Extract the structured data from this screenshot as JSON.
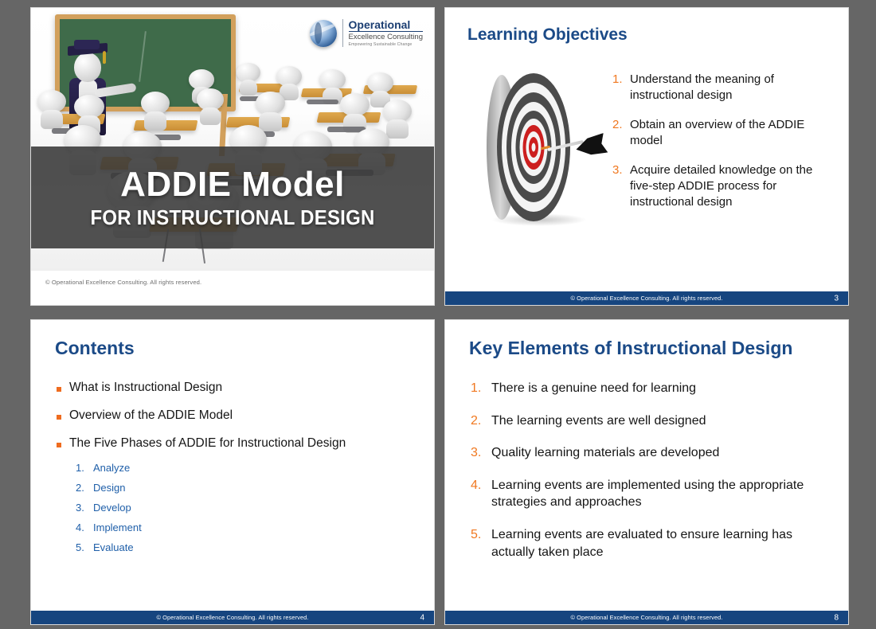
{
  "brand": {
    "logo_main": "Operational",
    "logo_sub": "Excellence Consulting",
    "logo_tagline": "Empowering Sustainable Change",
    "copyright": "© Operational Excellence Consulting.  All rights reserved.",
    "colors": {
      "navy": "#1b4a87",
      "footer_blue": "#16457f",
      "orange": "#f07820",
      "bullet_orange": "#ef6c1f",
      "sub_blue": "#1f5fa9",
      "page_background": "#666666",
      "banner_dark": "#393939"
    }
  },
  "slides": [
    {
      "kind": "title",
      "title": "ADDIE Model",
      "subtitle": "FOR INSTRUCTIONAL DESIGN",
      "image_name": "classroom-3d-illustration",
      "copyright": "© Operational Excellence Consulting.  All rights reserved."
    },
    {
      "kind": "learning-objectives",
      "title": "Learning Objectives",
      "image_name": "target-dartboard-with-dart",
      "items": [
        {
          "num": "1.",
          "text": "Understand the meaning of instructional design"
        },
        {
          "num": "2.",
          "text": "Obtain an overview of the ADDIE model"
        },
        {
          "num": "3.",
          "text": "Acquire detailed knowledge on the five-step ADDIE process for instructional design"
        }
      ],
      "footer": "© Operational Excellence Consulting.  All rights reserved.",
      "page": "3"
    },
    {
      "kind": "contents",
      "title": "Contents",
      "bullets": [
        {
          "text": "What is Instructional Design"
        },
        {
          "text": "Overview of the ADDIE Model"
        },
        {
          "text": "The Five Phases of ADDIE for Instructional Design"
        }
      ],
      "sub_items": [
        {
          "num": "1.",
          "text": "Analyze"
        },
        {
          "num": "2.",
          "text": "Design"
        },
        {
          "num": "3.",
          "text": "Develop"
        },
        {
          "num": "4.",
          "text": "Implement"
        },
        {
          "num": "5.",
          "text": "Evaluate"
        }
      ],
      "footer": "© Operational Excellence Consulting.  All rights reserved.",
      "page": "4"
    },
    {
      "kind": "key-elements",
      "title": "Key Elements of Instructional Design",
      "items": [
        {
          "num": "1.",
          "text": "There is a genuine need for learning"
        },
        {
          "num": "2.",
          "text": "The learning events are well designed"
        },
        {
          "num": "3.",
          "text": "Quality learning materials are developed"
        },
        {
          "num": "4.",
          "text": "Learning events are implemented using the appropriate strategies and approaches"
        },
        {
          "num": "5.",
          "text": "Learning events are evaluated to ensure learning has actually taken place"
        }
      ],
      "footer": "© Operational Excellence Consulting.  All rights reserved.",
      "page": "8"
    }
  ]
}
